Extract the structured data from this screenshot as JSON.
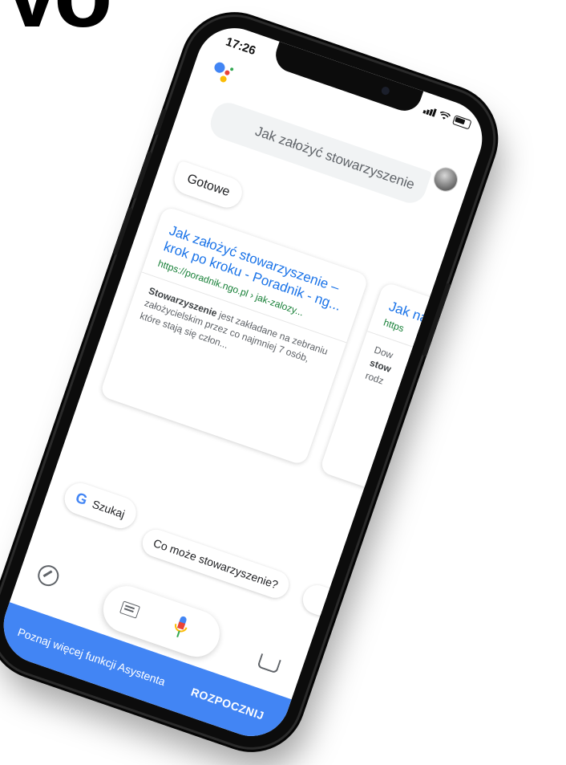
{
  "headline": "Vo",
  "status": {
    "time": "17:26"
  },
  "conversation": {
    "query": "Jak założyć stowarzyszenie",
    "reply": "Gotowe"
  },
  "results": [
    {
      "title": "Jak założyć stowarzyszenie – krok po kroku - Poradnik - ng...",
      "url": "https://poradnik.ngo.pl › jak-zalozy...",
      "snippet_bold": "Stowarzyszenie",
      "snippet": " jest zakładane na zebraniu założycielskim przez co najmniej 7 osób, które stają się człon..."
    },
    {
      "title": "Jak naj",
      "url": "https",
      "snippet_start": "Dow",
      "snippet_bold": "stow",
      "snippet_end": "rodz"
    }
  ],
  "suggestions": {
    "search": "Szukaj",
    "question": "Co może stowarzyszenie?"
  },
  "promo": {
    "text": "Poznaj więcej funkcji Asystenta",
    "cta": "ROZPOCZNIJ"
  },
  "colors": {
    "link": "#1a73e8",
    "url": "#188038",
    "promo_bg": "#4285f4"
  }
}
